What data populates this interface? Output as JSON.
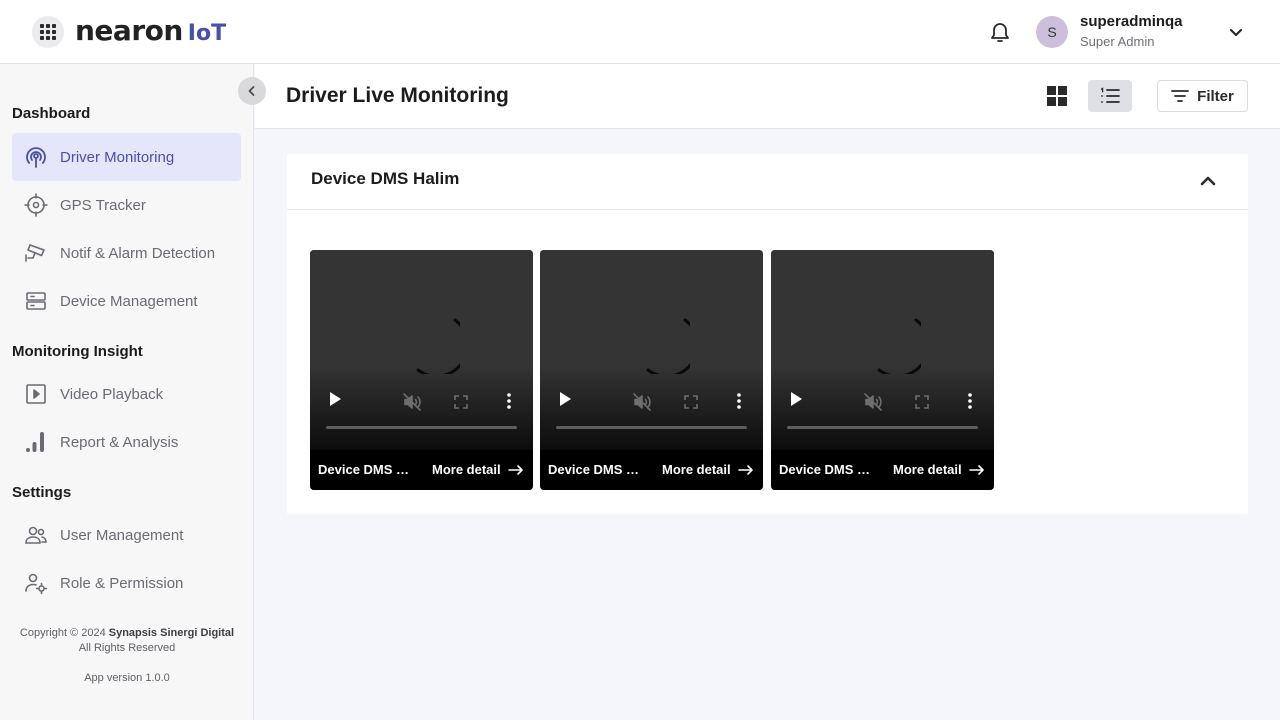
{
  "header": {
    "logo_main": "nearon",
    "logo_suffix": "IoT",
    "user": {
      "initial": "S",
      "name": "superadminqa",
      "role": "Super Admin"
    }
  },
  "sidebar": {
    "sections": [
      {
        "title": "Dashboard"
      },
      {
        "title": "Monitoring Insight"
      },
      {
        "title": "Settings"
      }
    ],
    "items": [
      {
        "label": "Driver Monitoring",
        "icon": "antenna-icon",
        "active": true
      },
      {
        "label": "GPS Tracker",
        "icon": "crosshair-icon"
      },
      {
        "label": "Notif & Alarm Detection",
        "icon": "cctv-icon"
      },
      {
        "label": "Device Management",
        "icon": "server-icon"
      },
      {
        "label": "Video Playback",
        "icon": "play-square-icon"
      },
      {
        "label": "Report & Analysis",
        "icon": "bar-chart-icon"
      },
      {
        "label": "User Management",
        "icon": "users-icon"
      },
      {
        "label": "Role & Permission",
        "icon": "user-gear-icon"
      }
    ],
    "copyright_prefix": "Copyright © 2024",
    "copyright_company": "Synapsis Sinergi Digital",
    "copyright_rights": "All Rights Reserved",
    "version": "App version 1.0.0"
  },
  "main": {
    "title": "Driver Live Monitoring",
    "filter_label": "Filter",
    "active_view": "list",
    "group": {
      "title": "Device DMS Halim",
      "expanded": true,
      "videos": [
        {
          "name": "Device DMS Halim",
          "detail_label": "More detail"
        },
        {
          "name": "Device DMS Halim",
          "detail_label": "More detail"
        },
        {
          "name": "Device DMS Halim",
          "detail_label": "More detail"
        }
      ]
    }
  },
  "colors": {
    "accent": "#4b4fa6",
    "active_bg": "#e5e6fa"
  }
}
